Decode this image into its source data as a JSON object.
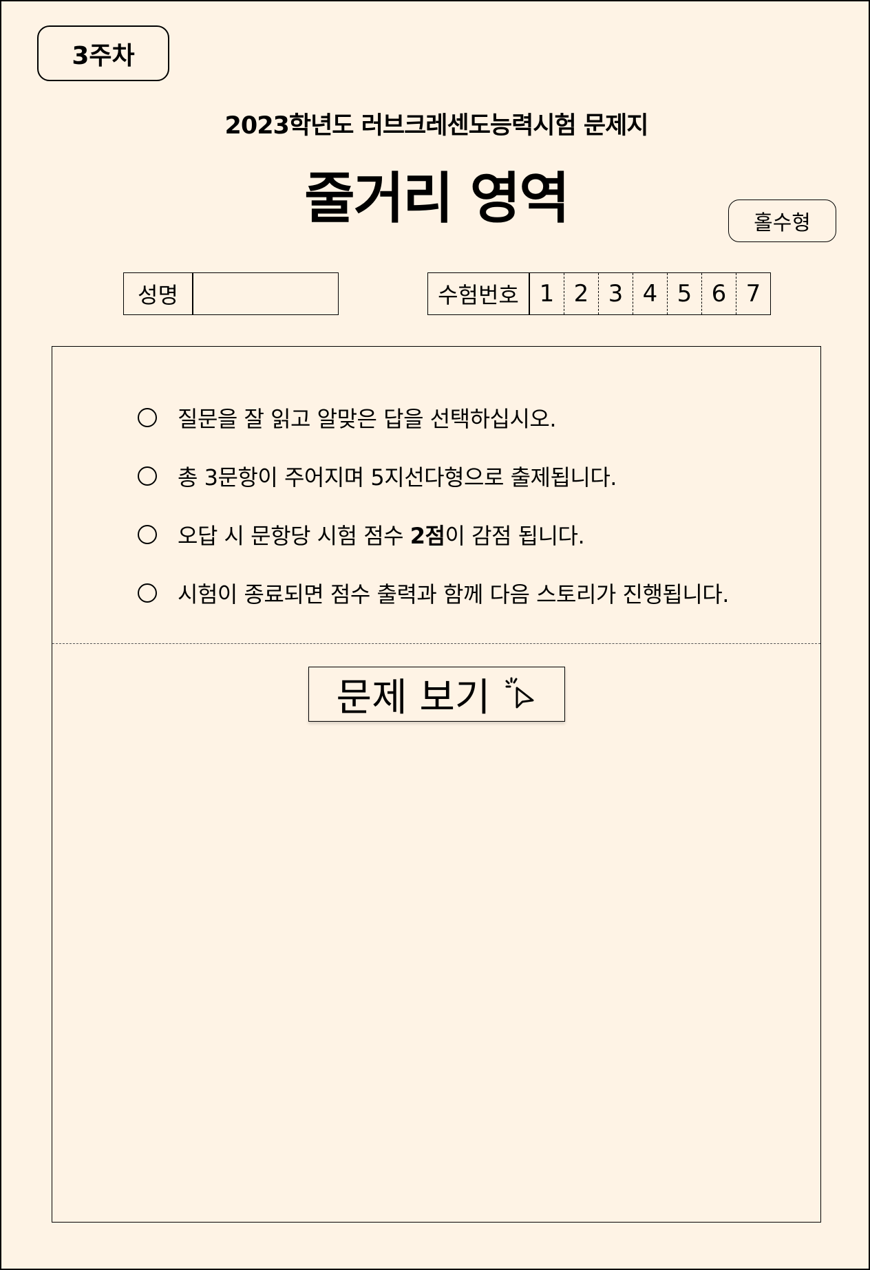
{
  "header": {
    "week_badge": "3주차",
    "subtitle": "2023학년도 러브크레센도능력시험 문제지",
    "title": "줄거리 영역",
    "type_badge": "홀수형"
  },
  "form": {
    "name_label": "성명",
    "name_value": "",
    "exam_number_label": "수험번호",
    "exam_digits": [
      "1",
      "2",
      "3",
      "4",
      "5",
      "6",
      "7"
    ]
  },
  "instructions": [
    {
      "text": "질문을 잘 읽고 알맞은 답을 선택하십시오."
    },
    {
      "text": "총 3문항이 주어지며 5지선다형으로 출제됩니다."
    },
    {
      "before": "오답 시 문항당 시험 점수 ",
      "bold": "2점",
      "after": "이 감점 됩니다."
    },
    {
      "text": "시험이 종료되면 점수 출력과 함께 다음 스토리가 진행됩니다."
    }
  ],
  "start_button": {
    "label": "문제 보기",
    "icon": "cursor-click-icon"
  }
}
